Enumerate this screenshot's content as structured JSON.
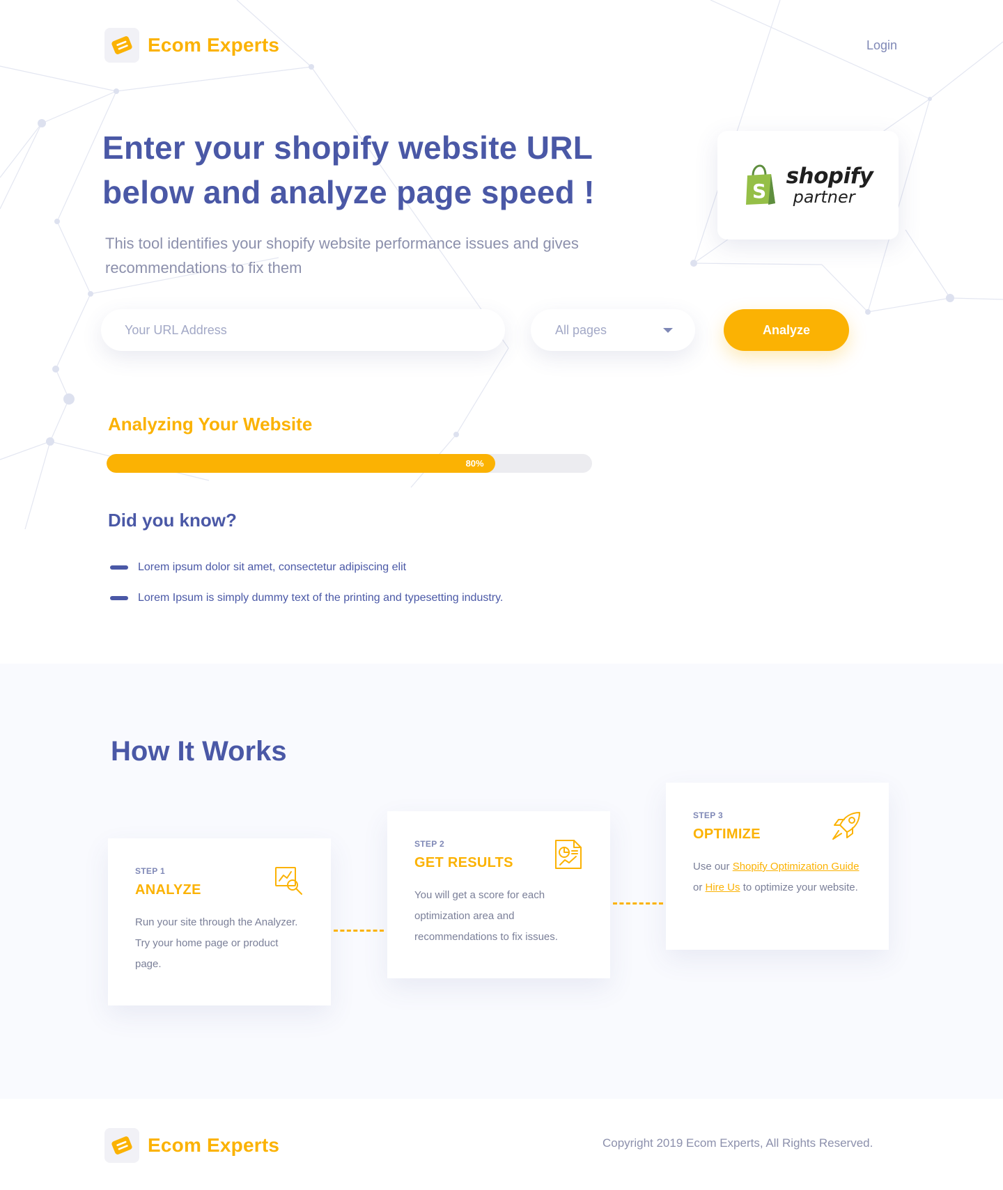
{
  "header": {
    "brand": "Ecom Experts",
    "login_label": "Login"
  },
  "hero": {
    "title_line1": "Enter your shopify website URL",
    "title_line2": "below and analyze page speed !",
    "subtitle_line1": "This tool identifies your shopify website performance issues and gives",
    "subtitle_line2": "recommendations to fix them",
    "partner_word1": "shopify",
    "partner_word2": "partner"
  },
  "form": {
    "url_placeholder": "Your URL Address",
    "url_value": "",
    "select_value": "All pages",
    "analyze_label": "Analyze"
  },
  "progress": {
    "title": "Analyzing Your Website",
    "percent": 80,
    "label": "80%"
  },
  "did_you_know": {
    "title": "Did you know?",
    "items": [
      "Lorem ipsum dolor sit amet, consectetur adipiscing elit",
      "Lorem Ipsum is simply dummy text of the printing and typesetting industry."
    ]
  },
  "how": {
    "title": "How It Works",
    "steps": [
      {
        "label": "STEP 1",
        "title": "ANALYZE",
        "desc": "Run your site through the Analyzer. Try your home page or product page.",
        "icon": "chart-magnifier-icon"
      },
      {
        "label": "STEP 2",
        "title": "GET RESULTS",
        "desc": "You will get a score for each optimization area and recommendations to fix issues.",
        "icon": "report-document-icon"
      },
      {
        "label": "STEP 3",
        "title": "OPTIMIZE",
        "desc_prefix": "Use our ",
        "link1": "Shopify Optimization Guide",
        "desc_mid": " or ",
        "link2": "Hire Us",
        "desc_suffix": " to optimize your website.",
        "icon": "rocket-icon"
      }
    ]
  },
  "footer": {
    "brand": "Ecom Experts",
    "copyright": "Copyright 2019 Ecom Experts, All Rights Reserved."
  },
  "colors": {
    "brand_yellow": "#fbb203",
    "primary_blue": "#4a58a6",
    "muted_text": "#8c90ac",
    "section_bg": "#f9fafe",
    "shopify_green": "#95bf47"
  }
}
